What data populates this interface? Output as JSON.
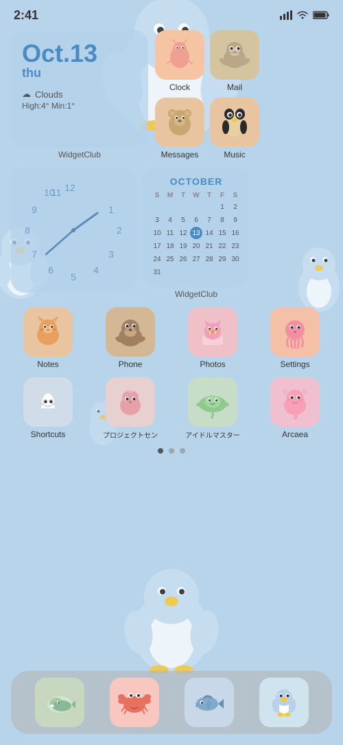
{
  "status": {
    "time": "2:41",
    "signal": "▂▄▆",
    "wifi": "WiFi",
    "battery": "Battery"
  },
  "date_widget": {
    "date": "Oct.13",
    "day": "thu",
    "weather_condition": "Clouds",
    "weather_icon": "☁",
    "temp": "High:4° Min:1°",
    "label": "WidgetClub"
  },
  "calendar": {
    "month": "OCTOBER",
    "headers": [
      "S",
      "M",
      "T",
      "W",
      "T",
      "F",
      "S"
    ],
    "days": [
      {
        "d": "",
        "empty": true
      },
      {
        "d": "",
        "empty": true
      },
      {
        "d": "1"
      },
      {
        "d": "2"
      },
      {
        "d": "3"
      },
      {
        "d": "4"
      },
      {
        "d": "5"
      },
      {
        "d": "6",
        "today": true
      },
      {
        "d": "7"
      },
      {
        "d": "8"
      },
      {
        "d": "9"
      },
      {
        "d": "10"
      },
      {
        "d": "11"
      },
      {
        "d": "12"
      },
      {
        "d": "13",
        "today": true
      },
      {
        "d": "14"
      },
      {
        "d": "15"
      },
      {
        "d": "16"
      },
      {
        "d": "17"
      },
      {
        "d": "18"
      },
      {
        "d": "19"
      },
      {
        "d": "20"
      },
      {
        "d": "21"
      },
      {
        "d": "22"
      },
      {
        "d": "23"
      },
      {
        "d": "24"
      },
      {
        "d": "25"
      },
      {
        "d": "26"
      },
      {
        "d": "27"
      },
      {
        "d": "28"
      },
      {
        "d": "29"
      },
      {
        "d": "30"
      },
      {
        "d": "31"
      }
    ],
    "today": 13
  },
  "widgetclub_label": "WidgetClub",
  "apps_top_row1": [
    {
      "id": "clock",
      "label": "Clock",
      "bg": "#f5c5a3"
    },
    {
      "id": "mail",
      "label": "Mail",
      "bg": "#d4c5a0"
    }
  ],
  "apps_top_row2": [
    {
      "id": "messages",
      "label": "Messages",
      "bg": "#e8c4a0"
    },
    {
      "id": "music",
      "label": "Music",
      "bg": "#e8c4a0"
    }
  ],
  "apps_main": [
    {
      "id": "notes",
      "label": "Notes",
      "bg": "#e8c4a0"
    },
    {
      "id": "phone",
      "label": "Phone",
      "bg": "#d4b896"
    },
    {
      "id": "photos",
      "label": "Photos",
      "bg": "#f0c0c8"
    },
    {
      "id": "settings",
      "label": "Settings",
      "bg": "#f5c0a8"
    },
    {
      "id": "shortcuts",
      "label": "Shortcuts",
      "bg": "#d0dde8"
    },
    {
      "id": "project",
      "label": "プロジェクトセン",
      "bg": "#e8d0d0"
    },
    {
      "id": "idolmaster",
      "label": "アイドルマスター",
      "bg": "#c8ddc8"
    },
    {
      "id": "arcaea",
      "label": "Arcaea",
      "bg": "#f0c0d0"
    }
  ],
  "dock_apps": [
    {
      "id": "dock1",
      "label": ""
    },
    {
      "id": "dock2",
      "label": ""
    },
    {
      "id": "dock3",
      "label": ""
    },
    {
      "id": "dock4",
      "label": ""
    }
  ],
  "page_dots": [
    {
      "active": true
    },
    {
      "active": false
    },
    {
      "active": false
    }
  ]
}
